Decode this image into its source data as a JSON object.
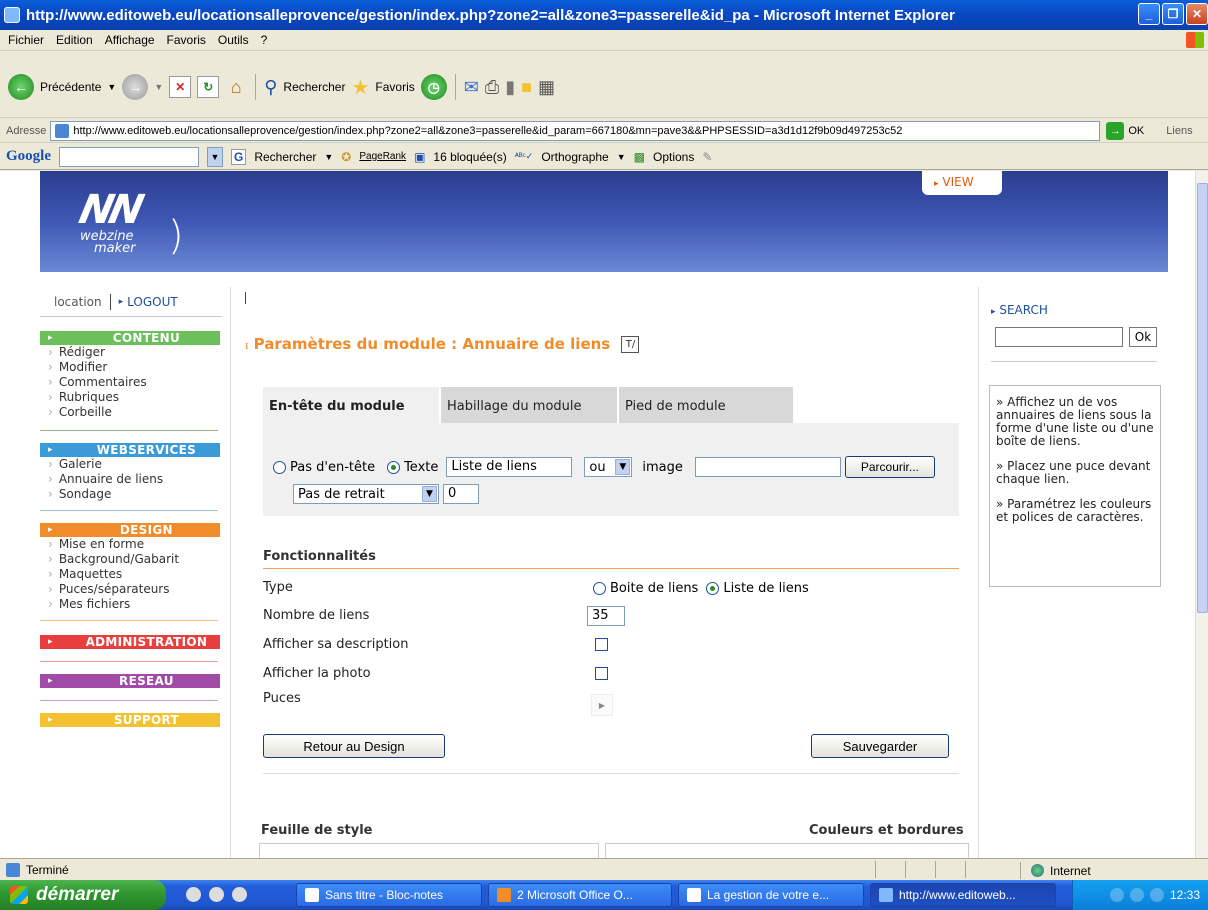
{
  "window": {
    "title": "http://www.editoweb.eu/locationsalleprovence/gestion/index.php?zone2=all&zone3=passerelle&id_pa - Microsoft Internet Explorer"
  },
  "menubar": [
    "Fichier",
    "Edition",
    "Affichage",
    "Favoris",
    "Outils",
    "?"
  ],
  "toolbar": {
    "back_label": "Précédente",
    "search_label": "Rechercher",
    "favorites_label": "Favoris"
  },
  "address": {
    "label": "Adresse",
    "url": "http://www.editoweb.eu/locationsalleprovence/gestion/index.php?zone2=all&zone3=passerelle&id_param=667180&mn=pave3&&PHPSESSID=a3d1d12f9b09d497253c52",
    "go_label": "OK",
    "links_label": "Liens"
  },
  "googlebar": {
    "logo": "Google",
    "search_label": "Rechercher",
    "pagerank_label": "PageRank",
    "blocked_label": "16 bloquée(s)",
    "spell_label": "Orthographe",
    "options_label": "Options"
  },
  "banner": {
    "logo_text": "NN",
    "logo_sub1": "webzine",
    "logo_sub2": "maker",
    "view_label": "VIEW"
  },
  "sidebar": {
    "user": "location",
    "logout": "LOGOUT",
    "sections": [
      {
        "title": "CONTENU",
        "color": "#6cbf5a",
        "items": [
          "Rédiger",
          "Modifier",
          "Commentaires",
          "Rubriques",
          "Corbeille"
        ]
      },
      {
        "title": "WEBSERVICES",
        "color": "#3b9bd8",
        "items": [
          "Galerie",
          "Annuaire de liens",
          "Sondage"
        ]
      },
      {
        "title": "DESIGN",
        "color": "#f08c2a",
        "items": [
          "Mise en forme",
          "Background/Gabarit",
          "Maquettes",
          "Puces/séparateurs",
          "Mes fichiers"
        ]
      },
      {
        "title": "ADMINISTRATION",
        "color": "#e83e3e",
        "items": []
      },
      {
        "title": "RESEAU",
        "color": "#a24aa8",
        "items": []
      },
      {
        "title": "SUPPORT",
        "color": "#f2c230",
        "items": []
      }
    ]
  },
  "main": {
    "title": "Paramètres du module : Annuaire de liens",
    "tabs": [
      "En-tête du module",
      "Habillage du module",
      "Pied de module"
    ],
    "header": {
      "opt_none": "Pas d'en-tête",
      "opt_text": "Texte",
      "text_value": "Liste de liens",
      "ou_select": "ou",
      "image_label": "image",
      "browse_button": "Parcourir...",
      "indent_select": "Pas de retrait",
      "indent_value": "0"
    },
    "fonct_title": "Fonctionnalités",
    "rows": {
      "type_label": "Type",
      "type_opt1": "Boite de liens",
      "type_opt2": "Liste de liens",
      "count_label": "Nombre de liens",
      "count_value": "35",
      "desc_label": "Afficher sa description",
      "photo_label": "Afficher la photo",
      "puces_label": "Puces"
    },
    "back_button": "Retour au Design",
    "save_button": "Sauvegarder",
    "style_title": "Feuille de style",
    "colors_title": "Couleurs et bordures"
  },
  "right": {
    "search_label": "SEARCH",
    "ok_label": "Ok",
    "help": [
      "» Affichez un de vos annuaires de liens sous la forme d'une liste ou d'une boîte de liens.",
      "» Placez une puce devant chaque lien.",
      "» Paramétrez les couleurs et polices de caractères."
    ]
  },
  "status": {
    "text": "Terminé",
    "zone": "Internet"
  },
  "taskbar": {
    "start": "démarrer",
    "tasks": [
      "Sans titre - Bloc-notes",
      "2 Microsoft Office O...",
      "La gestion de votre e...",
      "http://www.editoweb..."
    ],
    "clock": "12:33"
  }
}
